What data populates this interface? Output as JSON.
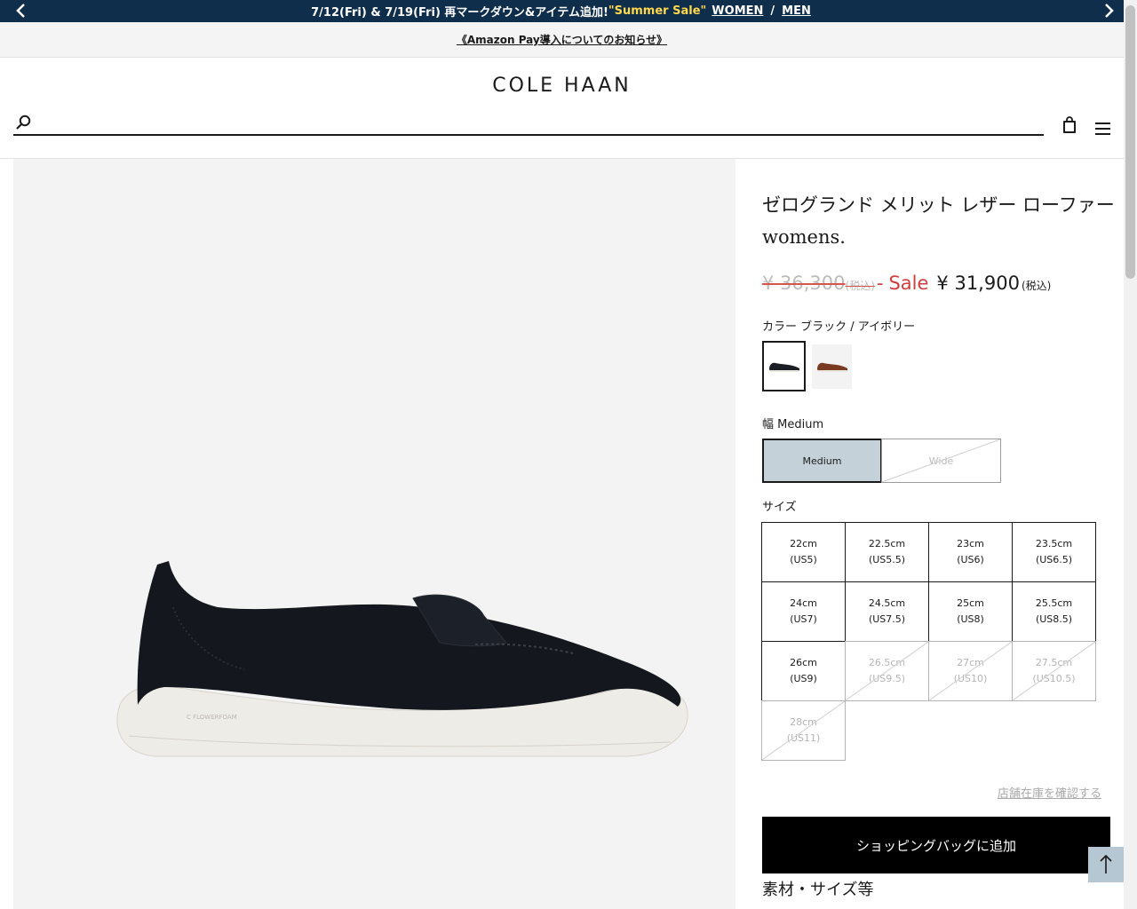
{
  "promo": {
    "text": "7/12(Fri) & 7/19(Fri) 再マークダウン&アイテム追加!",
    "highlight": "\"Summer Sale\"",
    "women": "WOMEN",
    "sep": "/",
    "men": "MEN",
    "bg_color": "#0f2e4b",
    "highlight_color": "#ffd84d"
  },
  "notice": {
    "text": "《Amazon Pay導入についてのお知らせ》"
  },
  "header": {
    "logo": "COLE HAAN",
    "search_placeholder": ""
  },
  "product": {
    "title": "ゼログランド メリット レザー ローファー",
    "subtitle": "womens.",
    "original_price": "¥ 36,300",
    "original_tax": "(税込)",
    "dash": "-",
    "sale_label": "Sale",
    "sale_price": "¥ 31,900",
    "sale_tax": "(税込)",
    "sale_color": "#d33c3c",
    "color_label": "カラー ブラック / アイボリー",
    "swatches": [
      {
        "name": "black-ivory",
        "selected": true
      },
      {
        "name": "brown",
        "selected": false
      }
    ],
    "width_label": "幅 Medium",
    "widths": [
      {
        "label": "Medium",
        "selected": true,
        "available": true
      },
      {
        "label": "Wide",
        "selected": false,
        "available": false
      }
    ],
    "size_label": "サイズ",
    "sizes": [
      {
        "cm": "22cm",
        "us": "(US5)",
        "available": true
      },
      {
        "cm": "22.5cm",
        "us": "(US5.5)",
        "available": true
      },
      {
        "cm": "23cm",
        "us": "(US6)",
        "available": true
      },
      {
        "cm": "23.5cm",
        "us": "(US6.5)",
        "available": true
      },
      {
        "cm": "24cm",
        "us": "(US7)",
        "available": true
      },
      {
        "cm": "24.5cm",
        "us": "(US7.5)",
        "available": true
      },
      {
        "cm": "25cm",
        "us": "(US8)",
        "available": true
      },
      {
        "cm": "25.5cm",
        "us": "(US8.5)",
        "available": true
      },
      {
        "cm": "26cm",
        "us": "(US9)",
        "available": true
      },
      {
        "cm": "26.5cm",
        "us": "(US9.5)",
        "available": false
      },
      {
        "cm": "27cm",
        "us": "(US10)",
        "available": false
      },
      {
        "cm": "27.5cm",
        "us": "(US10.5)",
        "available": false
      },
      {
        "cm": "28cm",
        "us": "(US11)",
        "available": false
      }
    ],
    "store_stock_link": "店舗在庫を確認する",
    "add_to_bag": "ショッピングバッグに追加",
    "spec_title": "素材・サイズ等"
  }
}
